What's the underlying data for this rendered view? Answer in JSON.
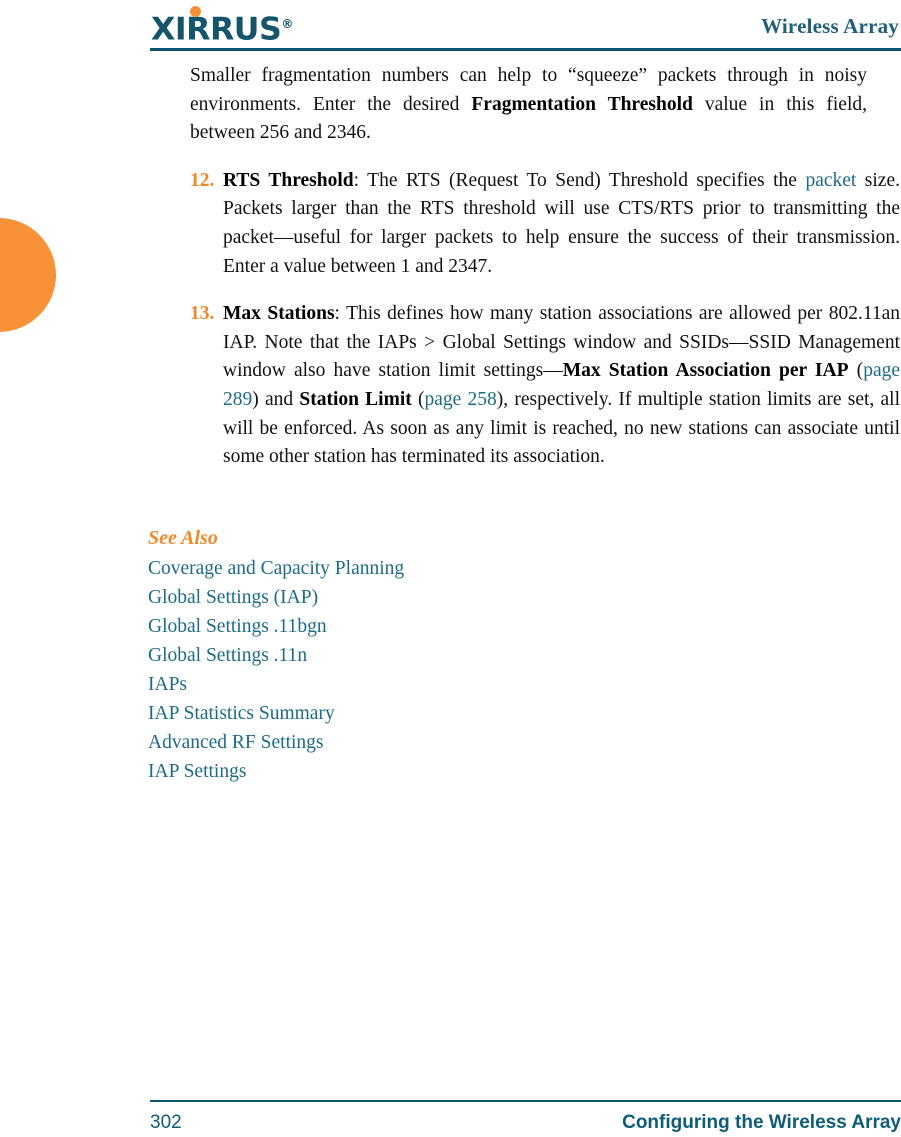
{
  "header": {
    "logo_text": "XIRRUS",
    "logo_trademark": "®",
    "title": "Wireless Array",
    "brand_color": "#14556b",
    "accent_color": "#f79238"
  },
  "edge_tab": {
    "name": "chapter-thumb-tab",
    "color": "#f79238"
  },
  "content": {
    "continued_paragraph": {
      "part1": "Smaller fragmentation numbers can help to “squeeze” packets through in noisy environments. Enter the desired ",
      "bold1": "Fragmentation Threshold",
      "part2": " value in this field, between 256 and 2346."
    },
    "items": [
      {
        "number": "12.",
        "term": "RTS Threshold",
        "text_a": ": The RTS (Request To Send) Threshold specifies the ",
        "link1": "packet",
        "text_b": " size. Packets larger than the RTS threshold will use CTS/RTS prior to transmitting the packet—useful for larger packets to help ensure the success of their transmission. Enter a value between 1 and 2347."
      },
      {
        "number": "13.",
        "term": "Max Stations",
        "text_a": ": This defines how many station associations are allowed per 802.11an IAP. Note that the IAPs > Global Settings window and SSIDs—SSID Management window also have station limit settings—",
        "bold_b": "Max Station Association per IAP",
        "text_c": " (",
        "link1": "page 289",
        "text_d": ") and ",
        "bold_c": "Station Limit",
        "text_e": " (",
        "link2": "page 258",
        "text_f": "), respectively. If multiple station limits are set, all will be enforced. As soon as any limit is reached, no new stations can associate until some other station has terminated its association."
      }
    ]
  },
  "see_also": {
    "title": "See Also",
    "links": [
      "Coverage and Capacity Planning",
      "Global Settings (IAP)",
      "Global Settings .11bgn",
      "Global Settings .11n",
      "IAPs",
      "IAP Statistics Summary",
      "Advanced RF Settings",
      "IAP Settings"
    ],
    "link_color": "#1d6b86",
    "title_color": "#f0882a"
  },
  "footer": {
    "page_number": "302",
    "section_title": "Configuring the Wireless Array",
    "color": "#0d5c78"
  }
}
